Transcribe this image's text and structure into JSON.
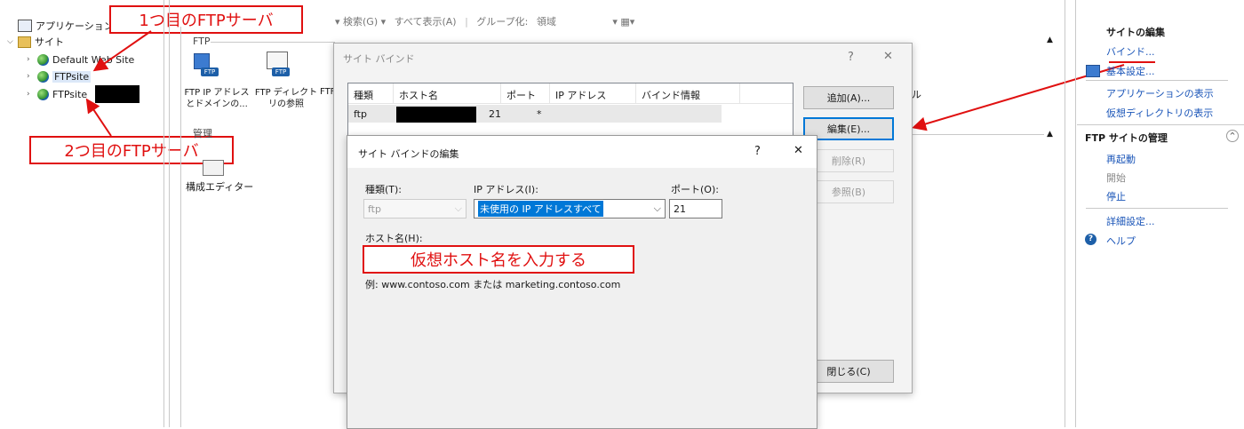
{
  "annotations": {
    "first_ftp": "1つ目のFTPサーバ",
    "second_ftp": "2つ目のFTPサーバ",
    "hostname_hint": "仮想ホスト名を入力する"
  },
  "tree": {
    "applications": "アプリケーション",
    "sites": "サイト",
    "items": [
      "Default Web Site",
      "FTPsite",
      "FTPsite"
    ]
  },
  "toolbar": {
    "search": "▾ 検索(G) ▾",
    "show_all": "すべて表示(A)",
    "group_by_label": "グループ化:",
    "group_by_value": "領域"
  },
  "features": {
    "ftp_section": "FTP",
    "mgmt_section": "管理",
    "ip_restrict_line1": "FTP IP アドレス",
    "ip_restrict_line2": "とドメインの...",
    "dir_browse_line1": "FTP ディレクト",
    "dir_browse_line2": "リの参照",
    "truncated": "FTF",
    "config_editor": "構成エディター",
    "right_truncated": "ル"
  },
  "bindings_dialog": {
    "title": "サイト バインド",
    "help": "?",
    "close": "✕",
    "columns": [
      "種類",
      "ホスト名",
      "ポート",
      "IP アドレス",
      "バインド情報"
    ],
    "row": {
      "type": "ftp",
      "port": "21",
      "ip": "*"
    },
    "add_button": "追加(A)...",
    "edit_button": "編集(E)...",
    "remove_button": "削除(R)",
    "browse_button": "参照(B)",
    "close_button": "閉じる(C)"
  },
  "edit_dialog": {
    "title": "サイト バインドの編集",
    "help": "?",
    "close": "✕",
    "type_label": "種類(T):",
    "type_value": "ftp",
    "ip_label": "IP アドレス(I):",
    "ip_value": "未使用の IP アドレスすべて",
    "port_label": "ポート(O):",
    "port_value": "21",
    "hostname_label": "ホスト名(H):",
    "example": "例: www.contoso.com または marketing.contoso.com"
  },
  "actions": {
    "edit_site_header": "サイトの編集",
    "bindings": "バインド...",
    "basic_settings": "基本設定...",
    "view_apps": "アプリケーションの表示",
    "view_vdirs": "仮想ディレクトリの表示",
    "ftp_manage_header": "FTP サイトの管理",
    "restart": "再起動",
    "start": "開始",
    "stop": "停止",
    "advanced": "詳細設定...",
    "help": "ヘルプ"
  }
}
